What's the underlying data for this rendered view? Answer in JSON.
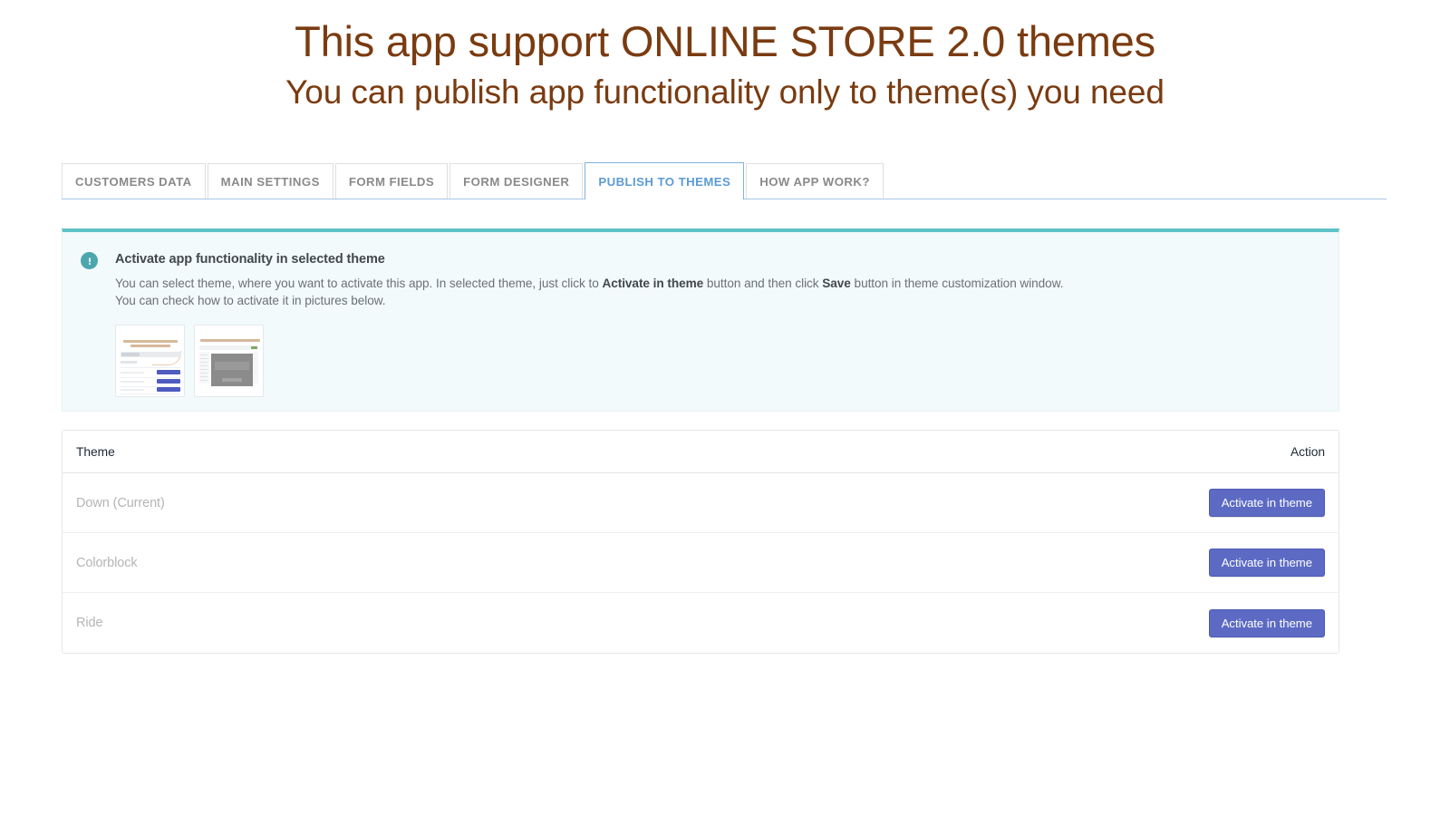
{
  "heading": {
    "main": "This app support ONLINE STORE 2.0 themes",
    "sub": "You can publish app functionality only to theme(s) you need",
    "color": "#7a3b10"
  },
  "tabs": [
    {
      "label": "CUSTOMERS DATA",
      "active": false
    },
    {
      "label": "MAIN SETTINGS",
      "active": false
    },
    {
      "label": "FORM FIELDS",
      "active": false
    },
    {
      "label": "FORM DESIGNER",
      "active": false
    },
    {
      "label": "PUBLISH TO THEMES",
      "active": true
    },
    {
      "label": "HOW APP WORK?",
      "active": false
    }
  ],
  "tab_colors": {
    "inactive_text": "#8a8a8a",
    "active_text": "#5b9bd5",
    "active_border": "#7eb2e0"
  },
  "banner": {
    "icon": "exclamation-circle-icon",
    "accent_color": "#5ec2c6",
    "background": "#f2fafb",
    "title": "Activate app functionality in selected theme",
    "line1_part1": "You can select theme, where you want to activate this app. In selected theme, just click to ",
    "line1_bold1": "Activate in theme",
    "line1_part2": " button and then click ",
    "line1_bold2": "Save",
    "line1_part3": " button in theme customization window.",
    "line2": "You can check how to activate it in pictures below.",
    "thumbnails": [
      {
        "name": "theme-selection-screenshot-thumbnail"
      },
      {
        "name": "theme-customization-screenshot-thumbnail"
      }
    ]
  },
  "table": {
    "columns": {
      "theme": "Theme",
      "action": "Action"
    },
    "rows": [
      {
        "theme": "Down (Current)",
        "action_label": "Activate in theme"
      },
      {
        "theme": "Colorblock",
        "action_label": "Activate in theme"
      },
      {
        "theme": "Ride",
        "action_label": "Activate in theme"
      }
    ],
    "button_color": "#5c6ac4"
  }
}
